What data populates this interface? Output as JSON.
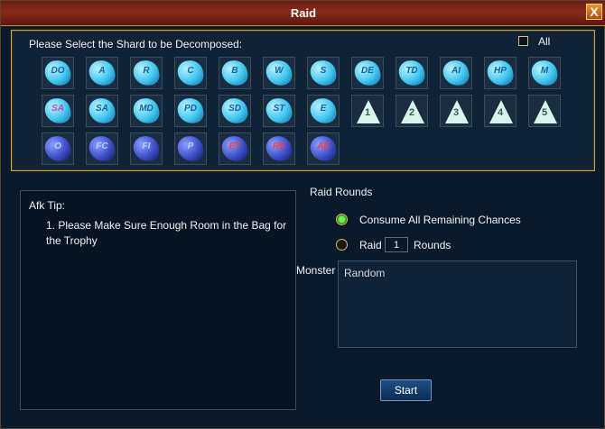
{
  "window": {
    "title": "Raid",
    "close_label": "X"
  },
  "shard_panel": {
    "prompt": "Please Select the Shard to be Decomposed:",
    "all_label": "All",
    "rows": [
      [
        {
          "label": "DO",
          "style": "crystal"
        },
        {
          "label": "A",
          "style": "crystal"
        },
        {
          "label": "R",
          "style": "crystal"
        },
        {
          "label": "C",
          "style": "crystal"
        },
        {
          "label": "B",
          "style": "crystal"
        },
        {
          "label": "W",
          "style": "crystal"
        },
        {
          "label": "S",
          "style": "crystal"
        },
        {
          "label": "DE",
          "style": "crystal"
        },
        {
          "label": "TD",
          "style": "crystal"
        },
        {
          "label": "AI",
          "style": "crystal"
        },
        {
          "label": "HP",
          "style": "crystal"
        },
        {
          "label": "M",
          "style": "crystal"
        }
      ],
      [
        {
          "label": "SA",
          "style": "crystal-pink"
        },
        {
          "label": "SA",
          "style": "crystal"
        },
        {
          "label": "MD",
          "style": "crystal"
        },
        {
          "label": "PD",
          "style": "crystal"
        },
        {
          "label": "SD",
          "style": "crystal"
        },
        {
          "label": "ST",
          "style": "crystal"
        },
        {
          "label": "E",
          "style": "crystal"
        },
        {
          "label": "1",
          "style": "cone"
        },
        {
          "label": "2",
          "style": "cone"
        },
        {
          "label": "3",
          "style": "cone"
        },
        {
          "label": "4",
          "style": "cone"
        },
        {
          "label": "5",
          "style": "cone"
        }
      ],
      [
        {
          "label": "O",
          "style": "dark"
        },
        {
          "label": "FC",
          "style": "dark"
        },
        {
          "label": "FI",
          "style": "dark"
        },
        {
          "label": "P",
          "style": "dark"
        },
        {
          "label": "ET",
          "style": "dark-red"
        },
        {
          "label": "RE",
          "style": "dark-red"
        },
        {
          "label": "AE",
          "style": "dark-red"
        }
      ]
    ]
  },
  "afk_tip": {
    "title": "Afk Tip:",
    "text": "1. Please Make Sure Enough Room in the Bag for the Trophy"
  },
  "raid_rounds": {
    "title": "Raid Rounds",
    "option_all_label": "Consume All Remaining Chances",
    "option_raid_label": "Raid",
    "rounds_value": "1",
    "rounds_suffix": "Rounds"
  },
  "monster": {
    "label": "Monster",
    "value": "Random"
  },
  "start_label": "Start",
  "colors": {
    "crystal": "#3ec6ee",
    "crystal_text": "#1d5fa0",
    "crystal_pink_text": "#d33fb8",
    "dark": "#3a4ec8",
    "dark_text": "#b9d0ff",
    "dark_red_text": "#ff3a3a",
    "cone": "#d8f4ea"
  }
}
